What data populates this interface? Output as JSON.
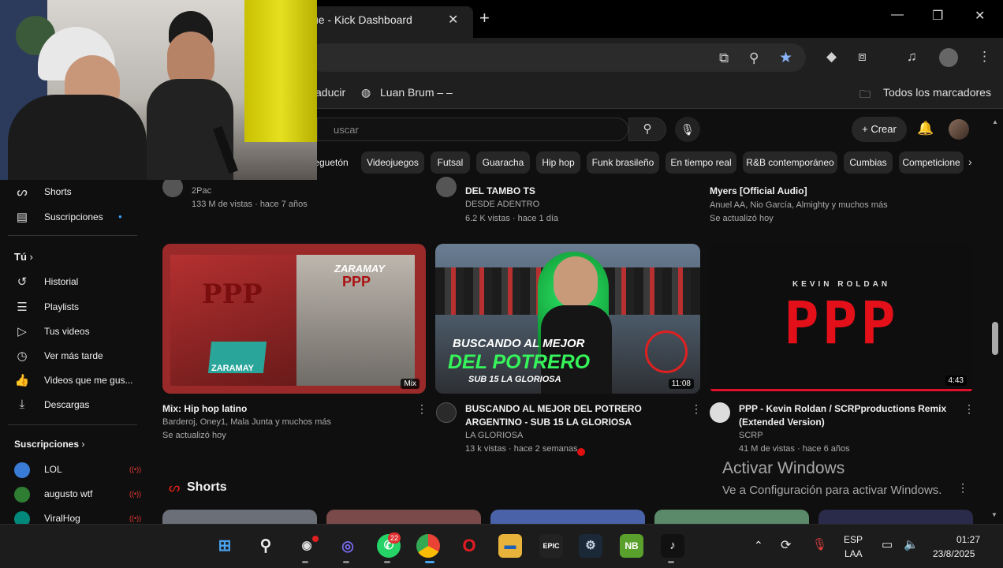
{
  "browser": {
    "tab_title": "ue - Kick Dashboard",
    "tab_close": "✕",
    "new_tab": "+",
    "window_controls": [
      "—",
      "❐",
      "✕"
    ],
    "bookmarks": [
      {
        "label": "aducir",
        "icon": "translate-icon"
      },
      {
        "label": "Luan Brum – –",
        "icon": "globe-icon"
      }
    ],
    "all_bookmarks": "Todos los marcadores"
  },
  "youtube_header": {
    "search_placeholder": "uscar",
    "create_label": "Crear"
  },
  "chips": [
    "eguetón",
    "Videojuegos",
    "Futsal",
    "Guaracha",
    "Hip hop",
    "Funk brasileño",
    "En tiempo real",
    "R&B contemporáneo",
    "Cumbias",
    "Competicione"
  ],
  "sidebar": {
    "top_items": [
      {
        "label": "Shorts",
        "icon": "shorts-icon"
      },
      {
        "label": "Suscripciones",
        "icon": "subscriptions-icon"
      }
    ],
    "you_heading": "Tú",
    "you_items": [
      {
        "label": "Historial",
        "icon": "history-icon"
      },
      {
        "label": "Playlists",
        "icon": "playlists-icon"
      },
      {
        "label": "Tus videos",
        "icon": "your-videos-icon"
      },
      {
        "label": "Ver más tarde",
        "icon": "watch-later-icon"
      },
      {
        "label": "Videos que me gus...",
        "icon": "liked-icon"
      },
      {
        "label": "Descargas",
        "icon": "download-icon"
      }
    ],
    "subs_heading": "Suscripciones",
    "subscriptions": [
      {
        "label": "LOL",
        "color": "#3a7bd5"
      },
      {
        "label": "augusto wtf",
        "color": "#2e7d32"
      },
      {
        "label": "ViralHog",
        "color": "#00897b"
      }
    ]
  },
  "top_row": [
    {
      "title_partial": "",
      "channel": "2Pac",
      "meta": "133 M de vistas · hace 7 años"
    },
    {
      "title_partial": "DEL TAMBO TS",
      "channel": "DESDE ADENTRO",
      "meta": "6.2 K vistas · hace 1 día"
    },
    {
      "title_partial": "Myers [Official Audio]",
      "channel": "Anuel AA, Nio García, Almighty y muchos más",
      "meta": "Se actualizó hoy"
    }
  ],
  "videos": [
    {
      "title": "Mix: Hip hop latino",
      "channel": "Barderoj, Oney1, Mala Junta y muchos más",
      "meta": "Se actualizó hoy",
      "badge": "Mix",
      "thumb_text": "ZARAMAY",
      "thumb_text2": "PPP"
    },
    {
      "title": "BUSCANDO AL MEJOR DEL POTRERO ARGENTINO - SUB 15 LA GLORIOSA",
      "channel": "LA GLORIOSA",
      "meta": "13 k vistas · hace 2 semanas",
      "badge": "11:08",
      "thumb_line1": "BUSCANDO AL MEJOR",
      "thumb_line2": "DEL POTRERO",
      "thumb_line3": "SUB 15 LA GLORIOSA"
    },
    {
      "title": "PPP - Kevin Roldan / SCRPproductions Remix (Extended Version)",
      "channel": "SCRP",
      "meta": "41 M de vistas · hace 6 años",
      "badge": "4:43",
      "thumb_artist": "KEVIN ROLDAN",
      "thumb_word": "PPP"
    }
  ],
  "shorts_heading": "Shorts",
  "watermark": {
    "line1": "Activar Windows",
    "line2": "Ve a Configuración para activar Windows."
  },
  "taskbar": {
    "whatsapp_badge": "22",
    "epic_label": "EPIC",
    "lang_top": "ESP",
    "lang_bottom": "LAA",
    "time": "01:27",
    "date": "23/8/2025"
  }
}
